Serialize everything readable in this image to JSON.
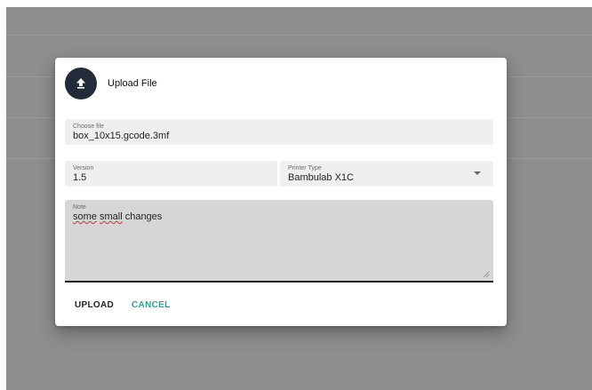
{
  "colors": {
    "overlay": "#8e8e8e",
    "avatar_bg": "#232b3a",
    "cancel_accent": "#26a69a"
  },
  "dialog": {
    "icon": "upload-arrow-icon",
    "title": "Upload File",
    "file": {
      "label": "Choose file",
      "value": "box_10x15.gcode.3mf"
    },
    "version": {
      "label": "Version",
      "value": "1.5"
    },
    "printer": {
      "label": "Printer Type",
      "value": "Bambulab X1C",
      "icon": "chevron-down-icon"
    },
    "note": {
      "label": "Note",
      "value_part1": "some",
      "value_part2": "small",
      "value_part3": "changes"
    },
    "actions": {
      "upload_label": "UPLOAD",
      "cancel_label": "CANCEL"
    }
  }
}
